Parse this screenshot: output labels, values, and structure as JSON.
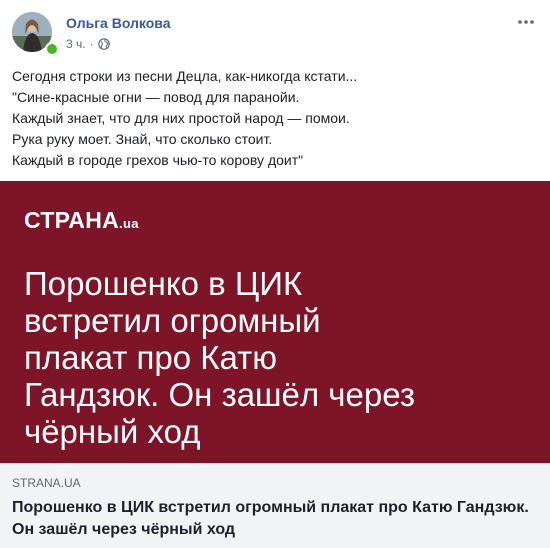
{
  "post": {
    "author": "Ольга Волкова",
    "time": "3 ч.",
    "separator": "·",
    "privacy_icon": "globe-icon",
    "more_icon": "more-options-icon",
    "text_lines": [
      "Сегодня строки из песни Децла, как-никогда кстати...",
      "\"Сине-красные огни — повод для паранойи.",
      "Каждый знает, что для них простой народ — помои.",
      "Рука руку моет. Знай, что сколько стоит.",
      "Каждый в городе грехов чью-то корову доит\""
    ]
  },
  "banner": {
    "brand": "СТРАНА",
    "brand_tld": ".ua",
    "headline_lines": [
      "Порошенко в ЦИК",
      "встретил огромный",
      "плакат про Катю",
      "Гандзюк. Он зашёл через",
      "чёрный ход"
    ],
    "background": "#7e1428"
  },
  "link_preview": {
    "domain": "STRANA.UA",
    "title": "Порошенко в ЦИК встретил огромный плакат про Катю Гандзюк. Он зашёл через чёрный ход"
  },
  "colors": {
    "author": "#385898",
    "online": "#42b72a",
    "preview_bg": "#f2f3f5"
  }
}
